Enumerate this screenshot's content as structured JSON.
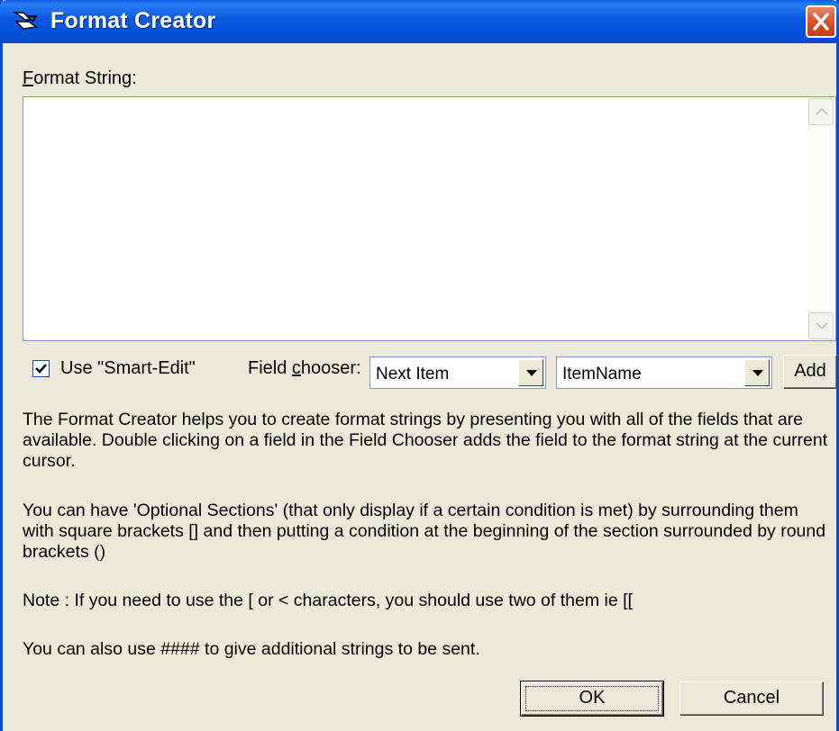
{
  "window": {
    "title": "Format Creator"
  },
  "format_string": {
    "label_first": "F",
    "label_rest": "ormat String:",
    "value": ""
  },
  "smart_edit": {
    "label": "Use \"Smart-Edit\"",
    "checked": true
  },
  "field_chooser": {
    "label_before": "Field ",
    "label_mnemonic": "c",
    "label_after": "hooser:",
    "combo1_value": "Next Item",
    "combo2_value": "ItemName",
    "add_label": "Add"
  },
  "help": {
    "p1": "The Format Creator helps you to create format strings by presenting you with all of the fields that are available. Double clicking on a field in the Field Chooser adds the field to the format string at the current cursor.",
    "p2": "You can have 'Optional Sections' (that only display if a certain condition is met) by surrounding them with square brackets [] and then putting a condition at the beginning of the section surrounded by round brackets ()",
    "p3": "Note : If you need to use the [ or < characters, you should use two of them ie [[",
    "p4": "You can also use #### to give additional strings to be sent."
  },
  "buttons": {
    "ok": "OK",
    "cancel": "Cancel"
  }
}
